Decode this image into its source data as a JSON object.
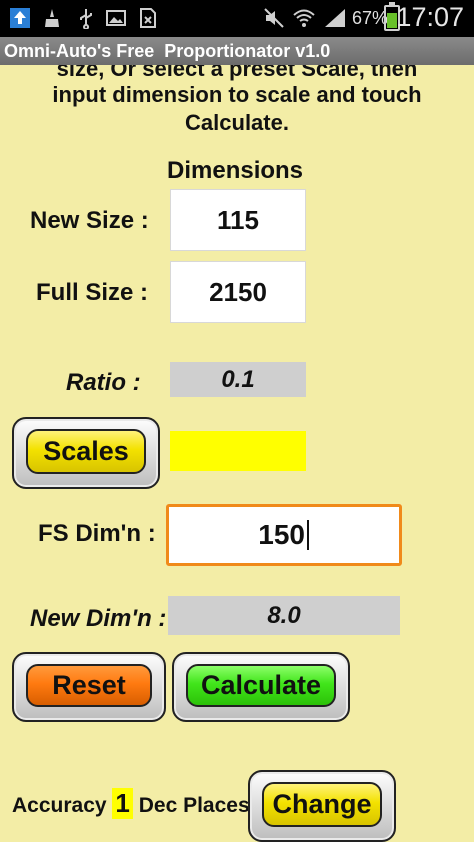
{
  "status_bar": {
    "icons": [
      "upload-icon",
      "cleaner-icon",
      "usb-icon",
      "image-icon",
      "sim-icon",
      "mute-icon",
      "wifi-icon",
      "signal-icon",
      "battery-icon"
    ],
    "battery_percent": "67%",
    "battery_level": 0.67,
    "time": "17:07"
  },
  "title_bar": {
    "title": "Omni-Auto's Free  Proportionator v1.0"
  },
  "instructions": {
    "line1": "size, Or select a preset Scale, then",
    "line2": "input dimension to scale and touch",
    "line3": "Calculate."
  },
  "dimensions": {
    "header": "Dimensions",
    "new_size_label": "New Size :",
    "new_size_value": "115",
    "full_size_label": "Full Size :",
    "full_size_value": "2150"
  },
  "ratio": {
    "label": "Ratio :",
    "value": "0.1"
  },
  "scales": {
    "button_label": "Scales",
    "selected_value": "",
    "swatch_color": "#ffff00"
  },
  "fs_dim": {
    "label": "FS Dim'n :",
    "value": "150"
  },
  "new_dim": {
    "label": "New Dim'n :",
    "value": "8.0"
  },
  "buttons": {
    "reset_label": "Reset",
    "calculate_label": "Calculate",
    "change_label": "Change"
  },
  "accuracy": {
    "prefix": "Accuracy",
    "value": "1",
    "suffix": "Dec Places"
  },
  "colors": {
    "background": "#f3eda6",
    "button_yellow": "#f3e200",
    "button_orange": "#ff7a10",
    "button_green": "#41e51b",
    "input_focus_border": "#f08a1a",
    "readout_bg": "#cfcfcf"
  }
}
